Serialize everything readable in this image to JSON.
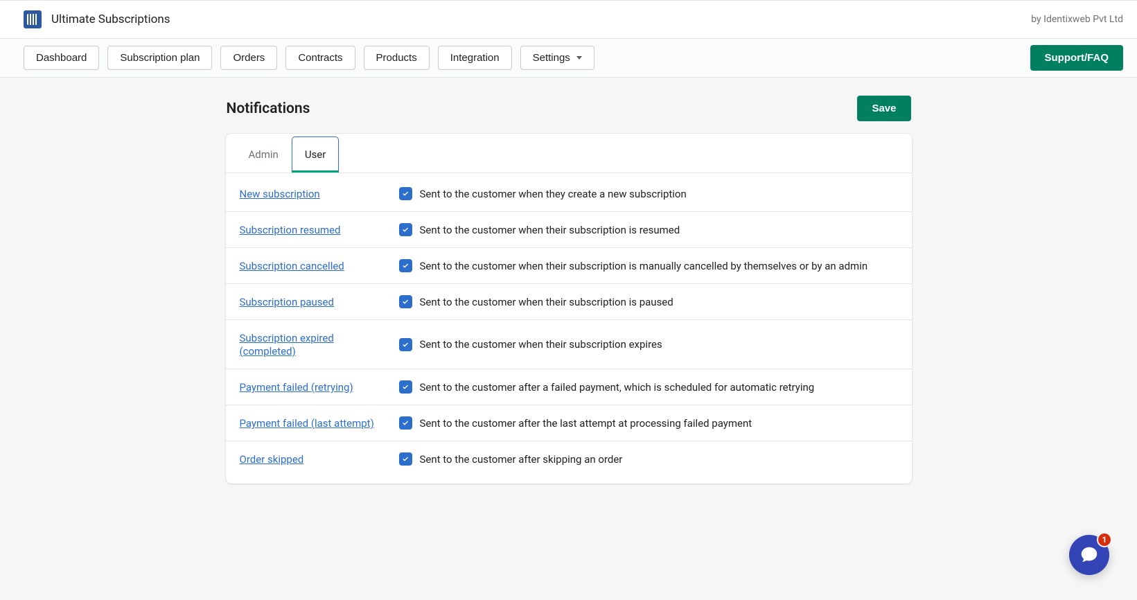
{
  "header": {
    "app_title": "Ultimate Subscriptions",
    "byline": "by Identixweb Pvt Ltd"
  },
  "nav": {
    "dashboard": "Dashboard",
    "subscription_plan": "Subscription plan",
    "orders": "Orders",
    "contracts": "Contracts",
    "products": "Products",
    "integration": "Integration",
    "settings": "Settings",
    "support": "Support/FAQ"
  },
  "page": {
    "title": "Notifications",
    "save": "Save"
  },
  "tabs": {
    "admin": "Admin",
    "user": "User"
  },
  "rows": [
    {
      "name": "New subscription",
      "desc": "Sent to the customer when they create a new subscription",
      "checked": true
    },
    {
      "name": "Subscription resumed",
      "desc": "Sent to the customer when their subscription is resumed",
      "checked": true
    },
    {
      "name": "Subscription cancelled",
      "desc": "Sent to the customer when their subscription is manually cancelled by themselves or by an admin",
      "checked": true
    },
    {
      "name": "Subscription paused",
      "desc": "Sent to the customer when their subscription is paused",
      "checked": true
    },
    {
      "name": "Subscription expired (completed)",
      "desc": "Sent to the customer when their subscription expires",
      "checked": true
    },
    {
      "name": "Payment failed (retrying)",
      "desc": "Sent to the customer after a failed payment, which is scheduled for automatic retrying",
      "checked": true
    },
    {
      "name": "Payment failed (last attempt)",
      "desc": "Sent to the customer after the last attempt at processing failed payment",
      "checked": true
    },
    {
      "name": "Order skipped",
      "desc": "Sent to the customer after skipping an order",
      "checked": true
    }
  ],
  "chat": {
    "badge": "1"
  }
}
